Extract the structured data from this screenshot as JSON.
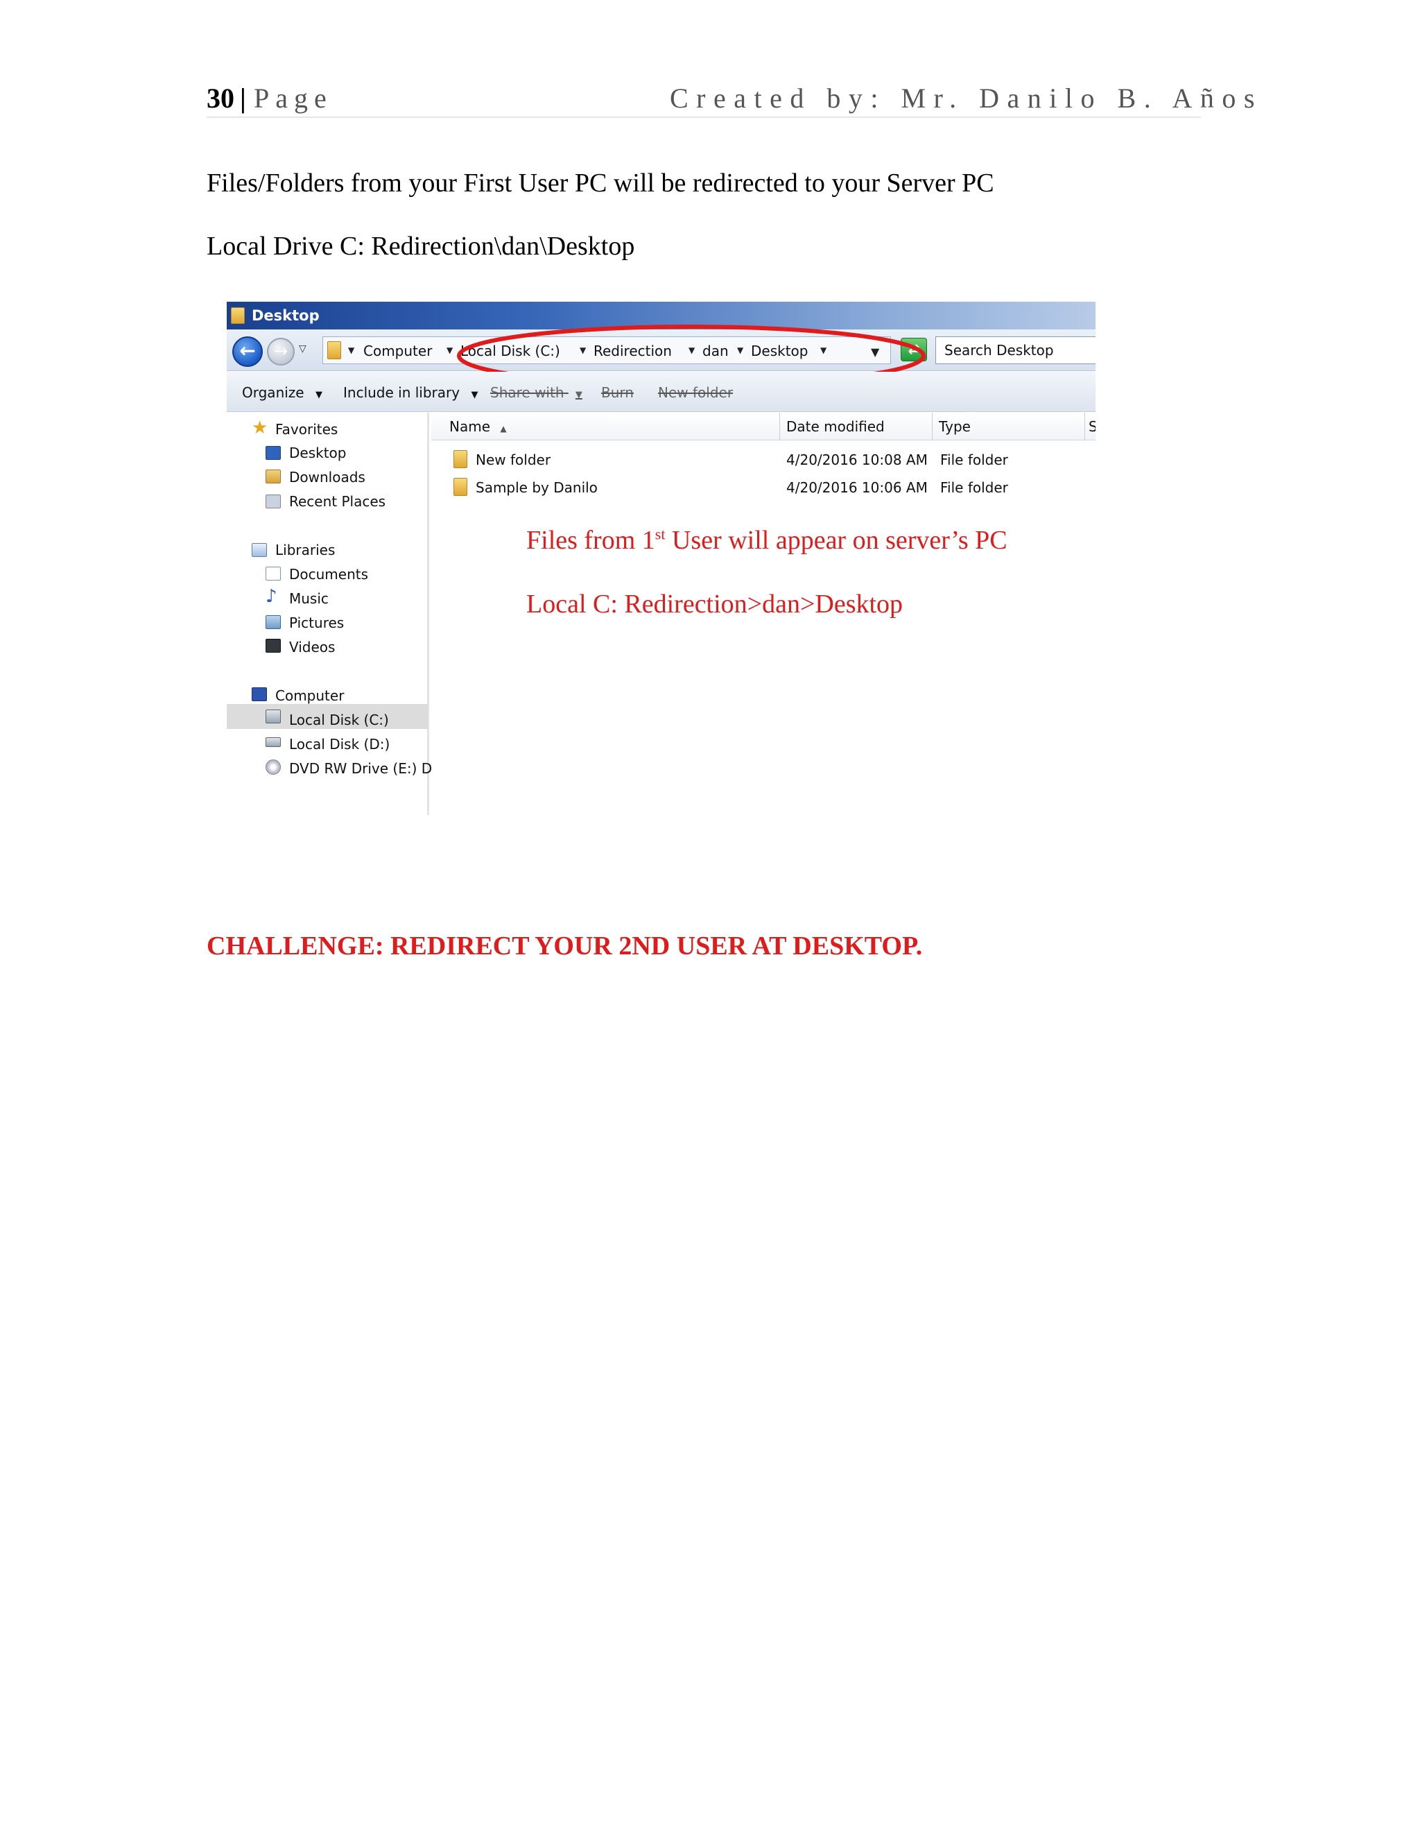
{
  "header": {
    "page_number": "30",
    "separator": "|",
    "page_word": "Page",
    "credit": "Created by: Mr. Danilo B. Años"
  },
  "paragraphs": {
    "p1": "Files/Folders from your First User PC will be redirected to your Server PC",
    "p2": "Local Drive C: Redirection\\dan\\Desktop"
  },
  "explorer": {
    "title": "Desktop",
    "breadcrumb": [
      "Computer",
      "Local Disk (C:)",
      "Redirection",
      "dan",
      "Desktop"
    ],
    "search_placeholder": "Search Desktop",
    "toolbar": {
      "organize": "Organize",
      "include_in_library": "Include in library",
      "share_with": "Share with",
      "burn": "Burn",
      "new_folder": "New folder"
    },
    "nav": {
      "favorites": "Favorites",
      "desktop": "Desktop",
      "downloads": "Downloads",
      "recent_places": "Recent Places",
      "libraries": "Libraries",
      "documents": "Documents",
      "music": "Music",
      "pictures": "Pictures",
      "videos": "Videos",
      "computer": "Computer",
      "local_c": "Local Disk (C:)",
      "local_d": "Local Disk (D:)",
      "dvd": "DVD RW Drive (E:) Dri"
    },
    "columns": {
      "name": "Name",
      "date_modified": "Date modified",
      "type": "Type",
      "size_stub": "S"
    },
    "files": [
      {
        "name": "New folder",
        "date": "4/20/2016 10:08 AM",
        "type": "File folder"
      },
      {
        "name": "Sample by Danilo",
        "date": "4/20/2016 10:06 AM",
        "type": "File folder"
      }
    ],
    "callout": {
      "line1_pre": "Files from 1",
      "line1_sup": "st",
      "line1_post": " User will appear on server’s PC",
      "line2": "Local C: Redirection>dan>Desktop"
    }
  },
  "challenge": "CHALLENGE:  REDIRECT YOUR 2ND USER AT DESKTOP.",
  "colors": {
    "accent_red": "#e01b1b",
    "title_bar_blue": "#1a3f8f"
  }
}
